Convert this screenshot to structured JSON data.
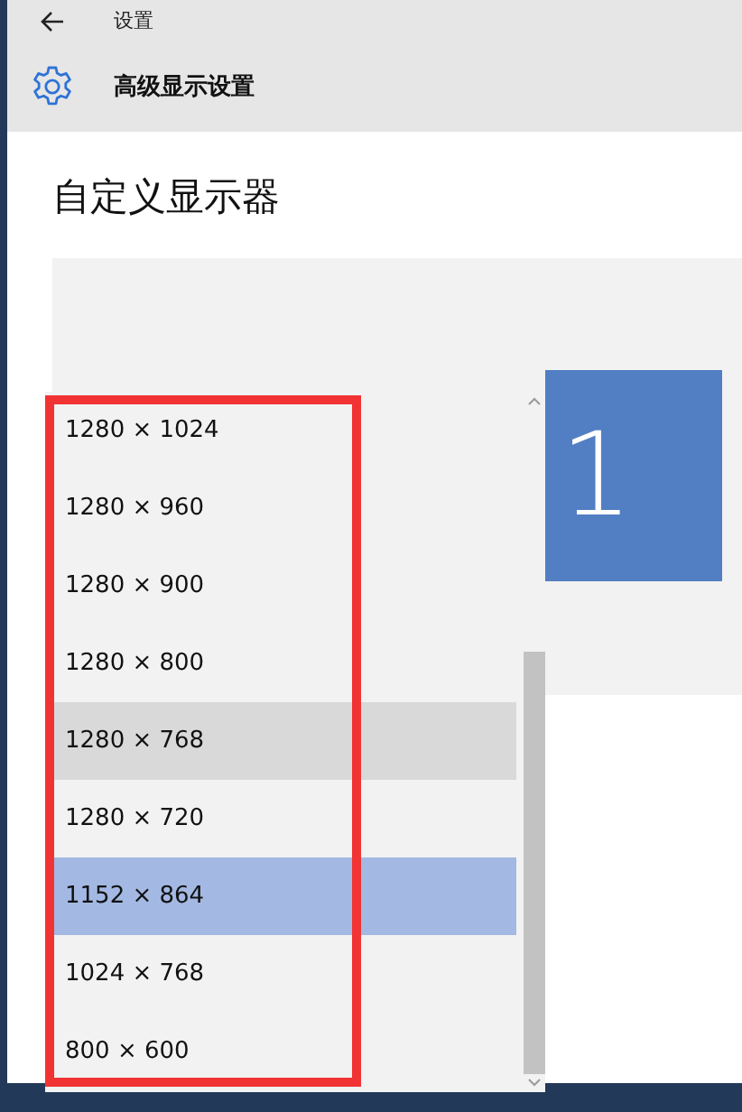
{
  "window": {
    "title": "设置"
  },
  "header": {
    "title": "高级显示设置"
  },
  "section": {
    "title": "自定义显示器"
  },
  "monitor": {
    "label": "1"
  },
  "resolution_list": {
    "items": [
      {
        "label": "1280 × 1024",
        "selected": false,
        "hovered": false
      },
      {
        "label": "1280 × 960",
        "selected": false,
        "hovered": false
      },
      {
        "label": "1280 × 900",
        "selected": false,
        "hovered": false
      },
      {
        "label": "1280 × 800",
        "selected": false,
        "hovered": false
      },
      {
        "label": "1280 × 768",
        "selected": false,
        "hovered": true
      },
      {
        "label": "1280 × 720",
        "selected": false,
        "hovered": false
      },
      {
        "label": "1152 × 864",
        "selected": true,
        "hovered": false
      },
      {
        "label": "1024 × 768",
        "selected": false,
        "hovered": false
      },
      {
        "label": "800 × 600",
        "selected": false,
        "hovered": false
      }
    ]
  }
}
